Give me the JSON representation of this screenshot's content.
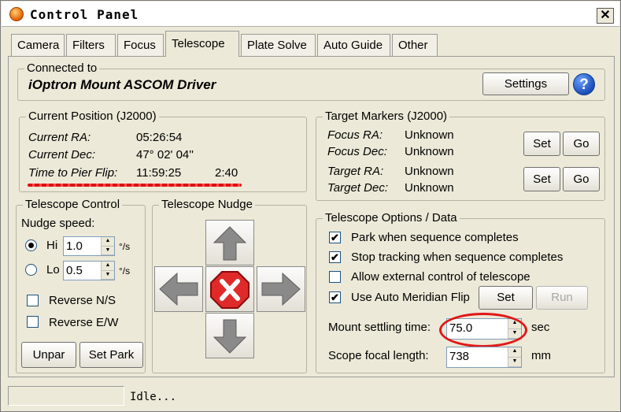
{
  "window": {
    "title": "Control Panel",
    "close_glyph": "✕"
  },
  "tabs": [
    "Camera",
    "Filters",
    "Focus",
    "Telescope",
    "Plate Solve",
    "Auto Guide",
    "Other"
  ],
  "connected": {
    "legend": "Connected to",
    "driver": "iOptron Mount ASCOM Driver",
    "settings_label": "Settings",
    "help_glyph": "?"
  },
  "position": {
    "legend": "Current Position (J2000)",
    "ra_label": "Current RA:",
    "ra_value": "05:26:54",
    "dec_label": "Current Dec:",
    "dec_value": "47° 02' 04''",
    "flip_label": "Time to Pier Flip:",
    "flip_value": "11:59:25",
    "flip_value2": "2:40"
  },
  "target": {
    "legend": "Target Markers (J2000)",
    "focus_ra_label": "Focus RA:",
    "focus_ra_value": "Unknown",
    "focus_dec_label": "Focus Dec:",
    "focus_dec_value": "Unknown",
    "target_ra_label": "Target RA:",
    "target_ra_value": "Unknown",
    "target_dec_label": "Target Dec:",
    "target_dec_value": "Unknown",
    "set_label": "Set",
    "go_label": "Go"
  },
  "control": {
    "legend": "Telescope Control",
    "nudge_speed": "Nudge speed:",
    "hi_label": "Hi",
    "hi_value": "1.0",
    "lo_label": "Lo",
    "lo_value": "0.5",
    "unit": "°/s",
    "selected": "Hi",
    "reverse_ns": "Reverse N/S",
    "reverse_ew": "Reverse E/W",
    "unpark_label": "Unpar",
    "setpark_label": "Set Park"
  },
  "nudge": {
    "legend": "Telescope Nudge"
  },
  "options": {
    "legend": "Telescope Options / Data",
    "park_label": "Park when sequence completes",
    "park_checked": true,
    "stop_label": "Stop tracking when sequence completes",
    "stop_checked": true,
    "external_label": "Allow external control of telescope",
    "external_checked": false,
    "meridian_label": "Use Auto Meridian Flip",
    "meridian_checked": true,
    "set_label": "Set",
    "run_label": "Run",
    "settling_label": "Mount settling time:",
    "settling_value": "75.0",
    "settling_unit": "sec",
    "focal_label": "Scope focal length:",
    "focal_value": "738",
    "focal_unit": "mm"
  },
  "status": {
    "text": "Idle..."
  }
}
